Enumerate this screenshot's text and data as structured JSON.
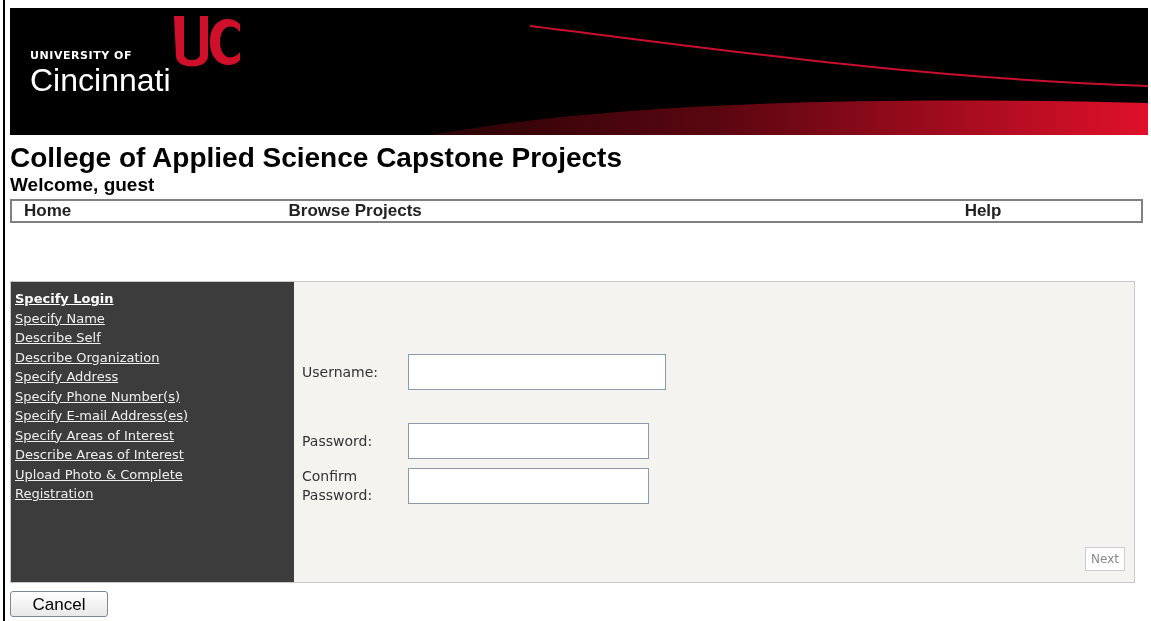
{
  "banner": {
    "logo_small": "UNIVERSITY OF",
    "logo_large": "Cincinnati"
  },
  "title": "College of Applied Science Capstone Projects",
  "welcome": "Welcome, guest",
  "nav": [
    {
      "label": "Home"
    },
    {
      "label": "Browse Projects"
    },
    {
      "label": "Help"
    }
  ],
  "steps": [
    {
      "label": "Specify Login",
      "selected": true
    },
    {
      "label": "Specify Name",
      "selected": false
    },
    {
      "label": "Describe Self",
      "selected": false
    },
    {
      "label": "Describe Organization",
      "selected": false
    },
    {
      "label": "Specify Address",
      "selected": false
    },
    {
      "label": "Specify Phone Number(s)",
      "selected": false
    },
    {
      "label": "Specify E-mail Address(es)",
      "selected": false
    },
    {
      "label": "Specify Areas of Interest",
      "selected": false
    },
    {
      "label": "Describe Areas of Interest",
      "selected": false
    },
    {
      "label": "Upload Photo & Complete Registration",
      "selected": false
    }
  ],
  "form": {
    "fields": [
      {
        "label": "Username:"
      },
      {
        "label": "Password:"
      },
      {
        "label": "Confirm Password:"
      }
    ],
    "next": {
      "label": "Next",
      "disabled": true
    }
  },
  "cancel": "Cancel"
}
